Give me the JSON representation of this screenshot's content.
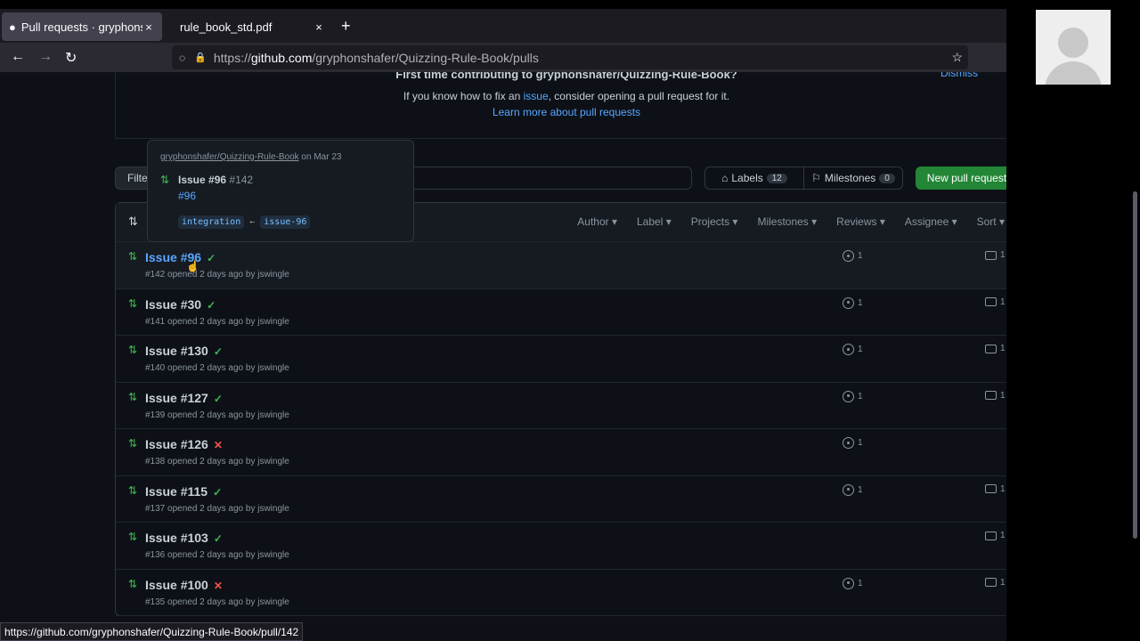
{
  "browser": {
    "tabs": [
      {
        "title": "Pull requests · gryphonsh",
        "close": "×"
      },
      {
        "title": "rule_book_std.pdf",
        "close": "×"
      }
    ],
    "new_tab": "+",
    "url_prefix": "https://",
    "url_host": "github.com",
    "url_path": "/gryphonshafer/Quizzing-Rule-Book/pulls",
    "status_url": "https://github.com/gryphonshafer/Quizzing-Rule-Book/pull/142"
  },
  "banner": {
    "title": "First time contributing to gryphonshafer/Quizzing-Rule-Book?",
    "text_before": "If you know how to fix an ",
    "issue_link": "issue",
    "text_after": ", consider opening a pull request for it.",
    "learn_more": "Learn more about pull requests",
    "dismiss": "Dismiss"
  },
  "toolbar": {
    "filter_label": "Filte",
    "labels_label": "Labels",
    "labels_count": "12",
    "milestones_label": "Milestones",
    "milestones_count": "0",
    "new_pr_label": "New pull request"
  },
  "list_header": {
    "filters": [
      "Author",
      "Label",
      "Projects",
      "Milestones",
      "Reviews",
      "Assignee",
      "Sort"
    ]
  },
  "rows": [
    {
      "title": "Issue #96",
      "status": "✓",
      "meta": "#142 opened 2 days ago by jswingle",
      "issues": "1",
      "comments": "1"
    },
    {
      "title": "Issue #30",
      "status": "✓",
      "meta": "#141 opened 2 days ago by jswingle",
      "issues": "1",
      "comments": "1"
    },
    {
      "title": "Issue #130",
      "status": "✓",
      "meta": "#140 opened 2 days ago by jswingle",
      "issues": "1",
      "comments": "1"
    },
    {
      "title": "Issue #127",
      "status": "✓",
      "meta": "#139 opened 2 days ago by jswingle",
      "issues": "1",
      "comments": "1"
    },
    {
      "title": "Issue #126",
      "status": "✕",
      "meta": "#138 opened 2 days ago by jswingle",
      "issues": "1",
      "comments": ""
    },
    {
      "title": "Issue #115",
      "status": "✓",
      "meta": "#137 opened 2 days ago by jswingle",
      "issues": "1",
      "comments": "1"
    },
    {
      "title": "Issue #103",
      "status": "✓",
      "meta": "#136 opened 2 days ago by jswingle",
      "issues": "",
      "comments": "1"
    },
    {
      "title": "Issue #100",
      "status": "✕",
      "meta": "#135 opened 2 days ago by jswingle",
      "issues": "1",
      "comments": "1"
    }
  ],
  "popover": {
    "repo": "gryphonshafer/Quizzing-Rule-Book",
    "date": " on Mar 23",
    "title": "Issue #96",
    "number": "#142",
    "link": "#96",
    "base_branch": "integration",
    "arrow": "←",
    "head_branch": "issue-96"
  },
  "colors": {
    "accent": "#58a6ff",
    "success": "#3fb950",
    "danger": "#f85149",
    "button_green": "#238636"
  }
}
